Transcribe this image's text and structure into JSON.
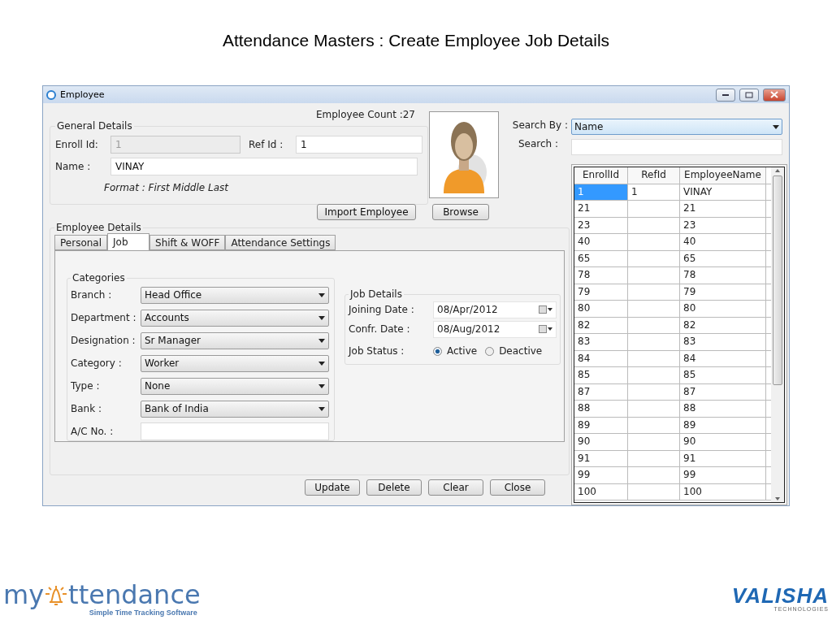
{
  "slide": {
    "title": "Attendance Masters : Create Employee Job Details"
  },
  "window": {
    "title": "Employee"
  },
  "employee_count": "Employee Count :27",
  "general_details": {
    "legend": "General Details",
    "enroll_id": {
      "label": "Enroll Id:",
      "value": "1",
      "disabled": true
    },
    "ref_id": {
      "label": "Ref Id :",
      "value": "1",
      "disabled": false
    },
    "name": {
      "label": "Name :",
      "value": "VINAY",
      "disabled": false
    },
    "format_hint": "Format : First Middle Last"
  },
  "photo_buttons": [
    "Import Employee",
    "Browse"
  ],
  "employee_details": {
    "legend": "Employee Details",
    "tabs": [
      {
        "label": "Personal",
        "selected": false
      },
      {
        "label": "Job",
        "selected": true
      },
      {
        "label": "Shift & WOFF",
        "selected": false
      },
      {
        "label": "Attendance Settings",
        "selected": false
      }
    ],
    "categories": {
      "legend": "Categories",
      "fields": [
        {
          "label": "Branch :",
          "value": "Head Office",
          "kind": "select"
        },
        {
          "label": "Department :",
          "value": "Accounts",
          "kind": "select"
        },
        {
          "label": "Designation :",
          "value": "Sr Manager",
          "kind": "select"
        },
        {
          "label": "Category :",
          "value": "Worker",
          "kind": "select"
        },
        {
          "label": "Type :",
          "value": "None",
          "kind": "select"
        },
        {
          "label": "Bank :",
          "value": "Bank of India",
          "kind": "select"
        },
        {
          "label": "A/C No. :",
          "kind": "text"
        }
      ]
    },
    "job_details": {
      "legend": "Job Details",
      "dates": [
        {
          "label": "Joining Date :",
          "value": "08/Apr/2012"
        },
        {
          "label": "Confr. Date :",
          "value": "08/Aug/2012"
        }
      ],
      "job_status": {
        "label": "Job Status :",
        "options": [
          {
            "label": "Active",
            "selected": true
          },
          {
            "label": "Deactive",
            "selected": false
          }
        ]
      }
    }
  },
  "actions": [
    "Update",
    "Delete",
    "Clear",
    "Close"
  ],
  "search": {
    "search_by": {
      "label": "Search By :",
      "value": "Name"
    },
    "search": {
      "label": "Search :"
    }
  },
  "table": {
    "columns": [
      "EnrollId",
      "RefId",
      "EmployeeName"
    ],
    "rows": [
      {
        "cells": [
          "1",
          "1",
          "VINAY"
        ],
        "selected": true
      },
      {
        "cells": [
          "21",
          "",
          "21"
        ],
        "selected": false
      },
      {
        "cells": [
          "23",
          "",
          "23"
        ],
        "selected": false
      },
      {
        "cells": [
          "40",
          "",
          "40"
        ],
        "selected": false
      },
      {
        "cells": [
          "65",
          "",
          "65"
        ],
        "selected": false
      },
      {
        "cells": [
          "78",
          "",
          "78"
        ],
        "selected": false
      },
      {
        "cells": [
          "79",
          "",
          "79"
        ],
        "selected": false
      },
      {
        "cells": [
          "80",
          "",
          "80"
        ],
        "selected": false
      },
      {
        "cells": [
          "82",
          "",
          "82"
        ],
        "selected": false
      },
      {
        "cells": [
          "83",
          "",
          "83"
        ],
        "selected": false
      },
      {
        "cells": [
          "84",
          "",
          "84"
        ],
        "selected": false
      },
      {
        "cells": [
          "85",
          "",
          "85"
        ],
        "selected": false
      },
      {
        "cells": [
          "87",
          "",
          "87"
        ],
        "selected": false
      },
      {
        "cells": [
          "88",
          "",
          "88"
        ],
        "selected": false
      },
      {
        "cells": [
          "89",
          "",
          "89"
        ],
        "selected": false
      },
      {
        "cells": [
          "90",
          "",
          "90"
        ],
        "selected": false
      },
      {
        "cells": [
          "91",
          "",
          "91"
        ],
        "selected": false
      },
      {
        "cells": [
          "99",
          "",
          "99"
        ],
        "selected": false
      },
      {
        "cells": [
          "100",
          "",
          "100"
        ],
        "selected": false
      }
    ]
  },
  "footer": {
    "left_logo": {
      "prefix": "my",
      "suffix": "ttendance",
      "tagline": "Simple Time Tracking Software"
    },
    "right_logo": {
      "name": "VALISHA",
      "tagline": "TECHNOLOGIES"
    }
  }
}
